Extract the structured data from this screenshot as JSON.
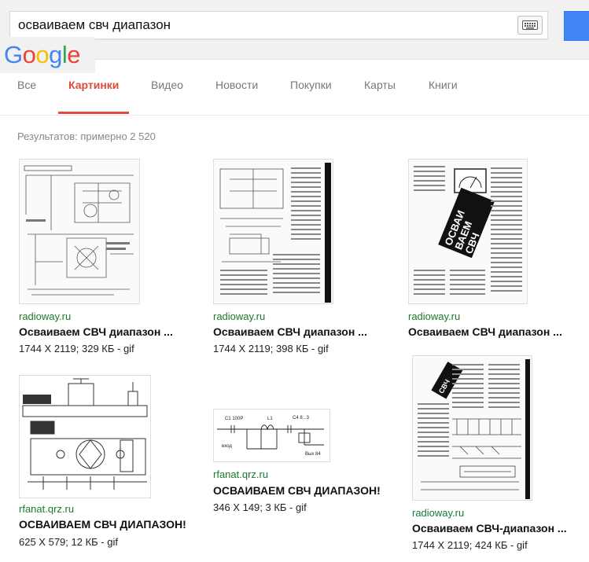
{
  "search": {
    "query": "осваиваем свч диапазон"
  },
  "logo": {
    "letters": [
      "G",
      "o",
      "o",
      "g",
      "l",
      "e"
    ],
    "colors": [
      "#4285f4",
      "#ea4335",
      "#fbbc05",
      "#4285f4",
      "#34a853",
      "#ea4335"
    ]
  },
  "tabs": [
    {
      "label": "Все"
    },
    {
      "label": "Картинки"
    },
    {
      "label": "Видео"
    },
    {
      "label": "Новости"
    },
    {
      "label": "Покупки"
    },
    {
      "label": "Карты"
    },
    {
      "label": "Книги"
    }
  ],
  "results_count": "Результатов: примерно 2 520",
  "images": [
    {
      "source": "radioway.ru",
      "title": "Осваиваем СВЧ диапазон ...",
      "meta": "1744 X 2119; 329 КБ - gif"
    },
    {
      "source": "radioway.ru",
      "title": "Осваиваем СВЧ диапазон ...",
      "meta": "1744 X 2119; 398 КБ - gif"
    },
    {
      "source": "radioway.ru",
      "title": "Осваиваем СВЧ диапазон ...",
      "meta": ""
    },
    {
      "source": "rfanat.qrz.ru",
      "title": "ОСВАИВАЕМ СВЧ ДИАПАЗОН!",
      "meta": "625 X 579; 12 КБ - gif"
    },
    {
      "source": "rfanat.qrz.ru",
      "title": "ОСВАИВАЕМ СВЧ ДИАПАЗОН!",
      "meta": "346 X 149; 3 КБ - gif"
    },
    {
      "source": "radioway.ru",
      "title": "Осваиваем СВЧ-диапазон ...",
      "meta": "1744 X 2119; 424 КБ - gif"
    }
  ],
  "accent": "#dd4b39",
  "link_color": "#1a7a2e",
  "icons": [
    "keyboard-icon"
  ]
}
